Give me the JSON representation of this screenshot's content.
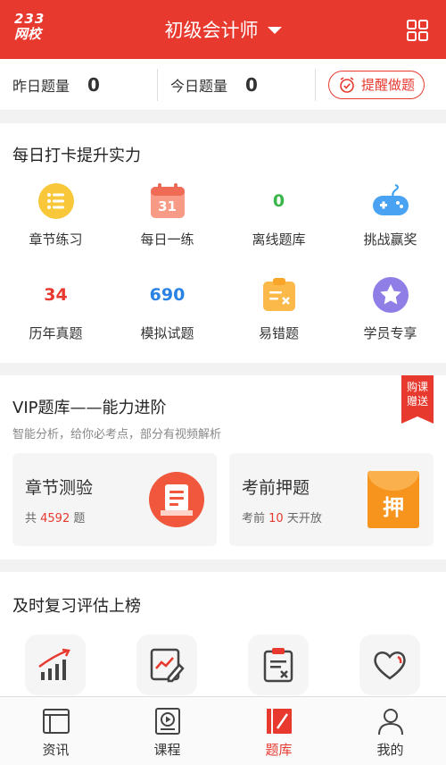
{
  "header": {
    "logo_top": "233",
    "logo_bottom": "网校",
    "title": "初级会计师",
    "grid_icon": "grid-icon"
  },
  "stats": {
    "yesterday_label": "昨日题量",
    "yesterday_value": "0",
    "today_label": "今日题量",
    "today_value": "0",
    "remind_label": "提醒做题"
  },
  "daily": {
    "title": "每日打卡提升实力",
    "items": [
      {
        "label": "章节练习",
        "icon": "list-icon"
      },
      {
        "label": "每日一练",
        "icon": "calendar-icon",
        "icon_text": "31"
      },
      {
        "label": "离线题库",
        "icon_text": "0",
        "color": "#3ab54a"
      },
      {
        "label": "挑战赢奖",
        "icon": "gamepad-icon"
      },
      {
        "label": "历年真题",
        "icon_text": "34",
        "color": "#e8392f"
      },
      {
        "label": "模拟试题",
        "icon_text": "690",
        "color": "#2a82e4"
      },
      {
        "label": "易错题",
        "icon": "mistake-icon"
      },
      {
        "label": "学员专享",
        "icon": "star-icon"
      }
    ]
  },
  "vip": {
    "title": "VIP题库——能力进阶",
    "subtitle": "智能分析，给你必考点，部分有视频解析",
    "badge_line1": "购课",
    "badge_line2": "赠送",
    "cards": [
      {
        "title": "章节测验",
        "sub_prefix": "共 ",
        "sub_value": "4592",
        "sub_suffix": " 题"
      },
      {
        "title": "考前押题",
        "sub_prefix": "考前 ",
        "sub_value": "10",
        "sub_suffix": " 天开放",
        "icon_text": "押"
      }
    ]
  },
  "review": {
    "title": "及时复习评估上榜"
  },
  "nav": {
    "items": [
      {
        "label": "资讯",
        "icon": "news-icon"
      },
      {
        "label": "课程",
        "icon": "course-icon"
      },
      {
        "label": "题库",
        "icon": "question-bank-icon"
      },
      {
        "label": "我的",
        "icon": "profile-icon"
      }
    ],
    "active_color": "#e8392f"
  },
  "colors": {
    "brand": "#e8392f"
  }
}
